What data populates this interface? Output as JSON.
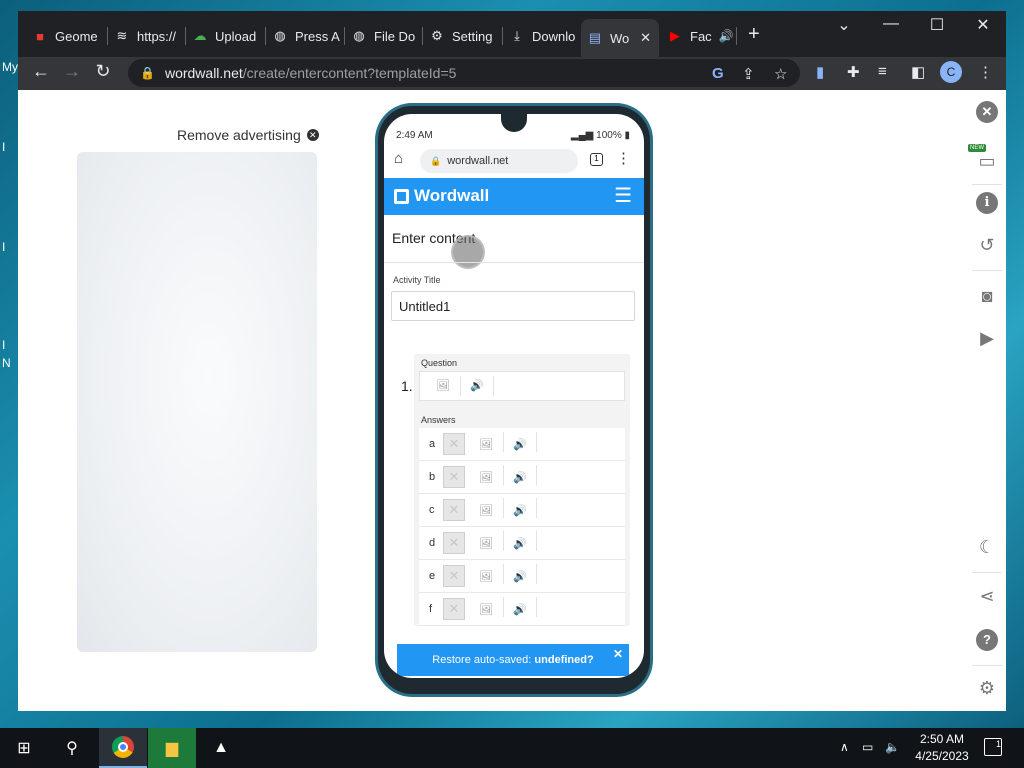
{
  "desktop": {
    "labels": [
      "My",
      "I",
      "I",
      "I",
      "N"
    ]
  },
  "browser": {
    "tabs": [
      {
        "title": "Geome",
        "icon": "pdf-icon",
        "glyph": "■",
        "color": "#e53935"
      },
      {
        "title": "https://",
        "icon": "stack-icon",
        "glyph": "≋",
        "color": "#e8eaed"
      },
      {
        "title": "Upload",
        "icon": "cloud-upload-icon",
        "glyph": "☁",
        "color": "#4caf50"
      },
      {
        "title": "Press A",
        "icon": "globe-icon",
        "glyph": "◍",
        "color": "#e8eaed"
      },
      {
        "title": "File Do",
        "icon": "globe-icon",
        "glyph": "◍",
        "color": "#e8eaed"
      },
      {
        "title": "Setting",
        "icon": "gear-icon",
        "glyph": "⚙",
        "color": "#e8eaed"
      },
      {
        "title": "Downlo",
        "icon": "download-icon",
        "glyph": "⤓",
        "color": "#e8eaed"
      },
      {
        "title": "Wo",
        "icon": "wordwall-tab-icon",
        "glyph": "▤",
        "color": "#8ab4f8"
      },
      {
        "title": "Fac",
        "icon": "youtube-icon",
        "glyph": "▶",
        "color": "#ff0000"
      }
    ],
    "active_tab_close": "✕",
    "new_tab": "+",
    "window_controls": {
      "minimize": "⌄",
      "restore": "—",
      "maximize": "☐",
      "close": "✕"
    },
    "address": {
      "host": "wordwall.net",
      "path": "/create/entercontent?templateId=5"
    },
    "profile_initial": "C"
  },
  "page": {
    "remove_advertising": "Remove advertising",
    "remove_x": "✕"
  },
  "phone": {
    "time": "2:49 AM",
    "battery": "100%",
    "mobile_url": "wordwall.net",
    "tab_count": "1",
    "logo": "Wordwall",
    "heading": "Enter content",
    "activity_title_label": "Activity Title",
    "activity_title_value": "Untitled1",
    "question_number": "1.",
    "question_label": "Question",
    "answers_label": "Answers",
    "answers": [
      "a",
      "b",
      "c",
      "d",
      "e",
      "f"
    ],
    "toast": {
      "text": "Restore auto-saved: ",
      "value": "undefined?",
      "close": "✕"
    }
  },
  "sidebar": {
    "new_badge": "NEW"
  },
  "taskbar": {
    "clock_time": "2:50 AM",
    "clock_date": "4/25/2023",
    "notifications": "1"
  }
}
